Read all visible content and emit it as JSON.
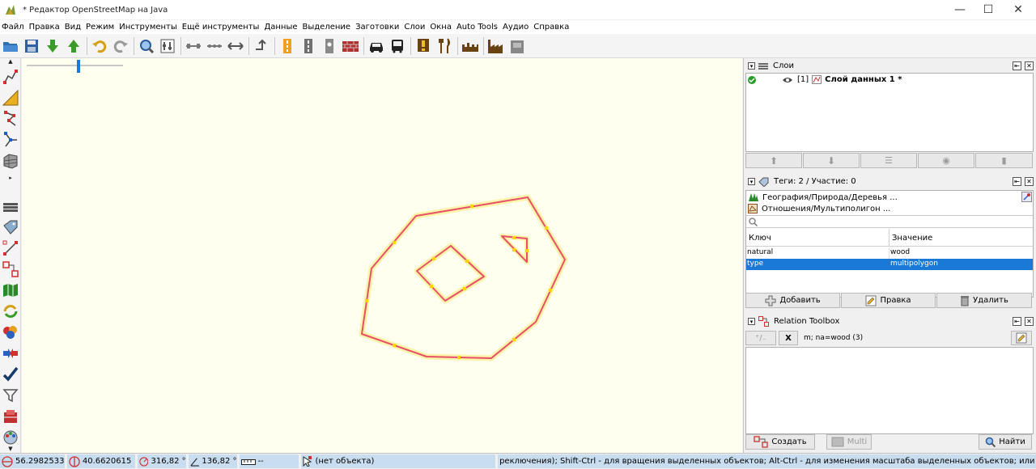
{
  "window": {
    "title": "* Редактор OpenStreetMap на Java",
    "minimize": "—",
    "maximize": "☐",
    "close": "✕"
  },
  "menubar": {
    "items": [
      "Файл",
      "Правка",
      "Вид",
      "Режим",
      "Инструменты",
      "Ещё инструменты",
      "Данные",
      "Выделение",
      "Заготовки",
      "Слои",
      "Окна",
      "Auto Tools",
      "Аудио",
      "Справка"
    ]
  },
  "layers_panel": {
    "title": "Слои",
    "layer_index": "[1]",
    "layer_name": "Слой данных 1 *"
  },
  "tags_panel": {
    "title": "Теги: 2 / Участие: 0",
    "presets": [
      "География/Природа/Деревья ...",
      "Отношения/Мультиполигон ..."
    ],
    "col_key": "Ключ",
    "col_value": "Значение",
    "rows": [
      {
        "key": "natural",
        "value": "wood"
      },
      {
        "key": "type",
        "value": "multipolygon"
      }
    ],
    "btn_add": "Добавить",
    "btn_edit": "Правка",
    "btn_delete": "Удалить"
  },
  "relation_panel": {
    "title": "Relation Toolbox",
    "x_label": "X",
    "relation_text": "m; na=wood (3)",
    "btn_create": "Создать",
    "btn_multi": "Multi",
    "btn_find": "Найти"
  },
  "statusbar": {
    "lat": "56.2982533",
    "lon": "40.6620615",
    "heading": "316,82 °",
    "angle": "136,82 °",
    "distance": "--",
    "selection": "(нет объекта)",
    "hint": "реключения); Shift-Ctrl - для вращения выделенных объектов; Alt-Ctrl - для изменения масштаба выделенных объектов; или для изменения"
  },
  "colors": {
    "map_bg": "#fffff0",
    "polygon_stroke": "#e8506a",
    "polygon_glow": "#f9f2a0",
    "selection_blue": "#1a78d6",
    "statusbar_cell": "#c9ddf0"
  }
}
